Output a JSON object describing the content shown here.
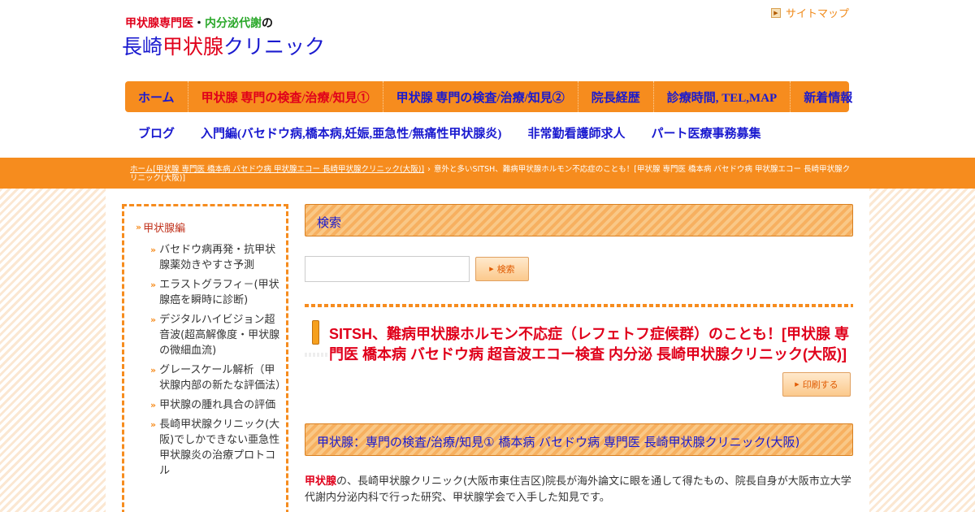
{
  "header": {
    "tagline_a": "甲状腺専門医",
    "tagline_dot": "・",
    "tagline_b": "内分泌代謝",
    "tagline_c": "の",
    "title_a": "長崎",
    "title_b": "甲状腺",
    "title_c": "クリニック",
    "sitemap_label": "サイトマップ"
  },
  "nav": {
    "row1": [
      "ホーム",
      "甲状腺 専門の検査/治療/知見①",
      "甲状腺 専門の検査/治療/知見②",
      "院長経歴",
      "診療時間, TEL,MAP",
      "新着情報"
    ],
    "row2": [
      "ブログ",
      "入門編(バセドウ病,橋本病,妊娠,亜急性/無痛性甲状腺炎)",
      "非常勤看護師求人",
      "パート医療事務募集"
    ],
    "active_index": 1
  },
  "breadcrumb": {
    "link": "ホーム[甲状腺 専門医 橋本病 バセドウ病 甲状腺エコー 長崎甲状腺クリニック(大阪)]",
    "separator": "›",
    "current": "意外と多いSITSH、難病甲状腺ホルモン不応症のことも！[甲状腺 専門医 橋本病 バセドウ病 甲状腺エコー 長崎甲状腺クリニック(大阪)]"
  },
  "sidebar": {
    "heading": "甲状腺編",
    "items": [
      "バセドウ病再発・抗甲状腺薬効きやすさ予測",
      "エラストグラフィ－(甲状腺癌を瞬時に診断)",
      "デジタルハイビジョン超音波(超高解像度・甲状腺の微細血流)",
      "グレースケール解析（甲状腺内部の新たな評価法）",
      "甲状腺の腫れ具合の評価",
      "長崎甲状腺クリニック(大阪)でしかできない亜急性甲状腺炎の治療プロトコル"
    ]
  },
  "main": {
    "search_heading": "検索",
    "search_value": "",
    "search_button": "検索",
    "page_title": "SITSH、難病甲状腺ホルモン不応症（レフェトフ症候群）のことも！[甲状腺 専門医 橋本病 バセドウ病 超音波エコー検査 内分泌 長崎甲状腺クリニック(大阪)]",
    "print_button": "印刷する",
    "section_heading": "甲状腺：専門の検査/治療/知見① 橋本病 バセドウ病 専門医 長崎甲状腺クリニック(大阪)",
    "body_highlight": "甲状腺",
    "body_text": "の、長崎甲状腺クリニック(大阪市東住吉区)院長が海外論文に眼を通して得たもの、院長自身が大阪市立大学　代謝内分泌内科で行った研究、甲状腺学会で入手した知見です。"
  },
  "colors": {
    "accent_orange": "#f68c1e",
    "nav_text_blue": "#1a1acf",
    "active_red": "#e0001b",
    "tagline_green": "#2aa82a"
  }
}
